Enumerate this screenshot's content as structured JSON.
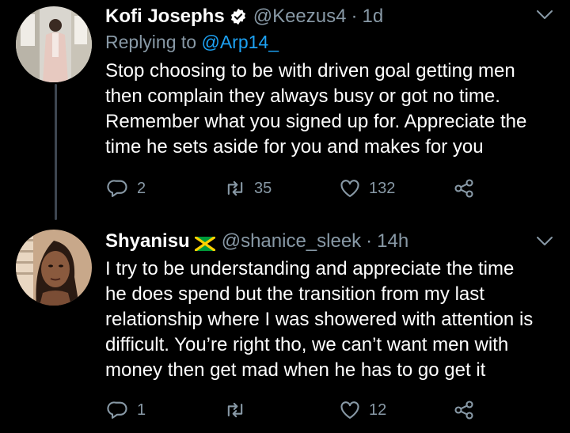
{
  "tweets": [
    {
      "name": "Kofi Josephs",
      "handle": "@Keezus4",
      "time": "1d",
      "replying_prefix": "Replying to ",
      "replying_to": "@Arp14_",
      "text": "Stop choosing to be with driven goal getting men\nthen complain they always busy or got no time.\nRemember what you signed up for. Appreciate the\ntime he sets aside for you and makes for you",
      "replies": "2",
      "retweets": "35",
      "likes": "132",
      "verified": true
    },
    {
      "name": "Shyanisu",
      "handle": "@shanice_sleek",
      "time": "14h",
      "flag": "jamaica-flag",
      "text": "I try to be understanding and appreciate the time\nhe does spend but the transition  from my last\nrelationship where I was showered with attention is\ndifficult. You’re right tho, we can’t want men with\nmoney then get mad when he has to go get it",
      "replies": "1",
      "retweets": "",
      "likes": "12"
    }
  ],
  "separator": "·",
  "colors": {
    "background": "#000000",
    "text": "#ffffff",
    "muted": "#8899a6",
    "link": "#1da1f2",
    "thread_line": "#3d4650"
  },
  "icons": [
    "verified-badge-icon",
    "jamaica-flag-icon",
    "caret-down-icon",
    "reply-icon",
    "retweet-icon",
    "like-icon",
    "share-icon"
  ]
}
